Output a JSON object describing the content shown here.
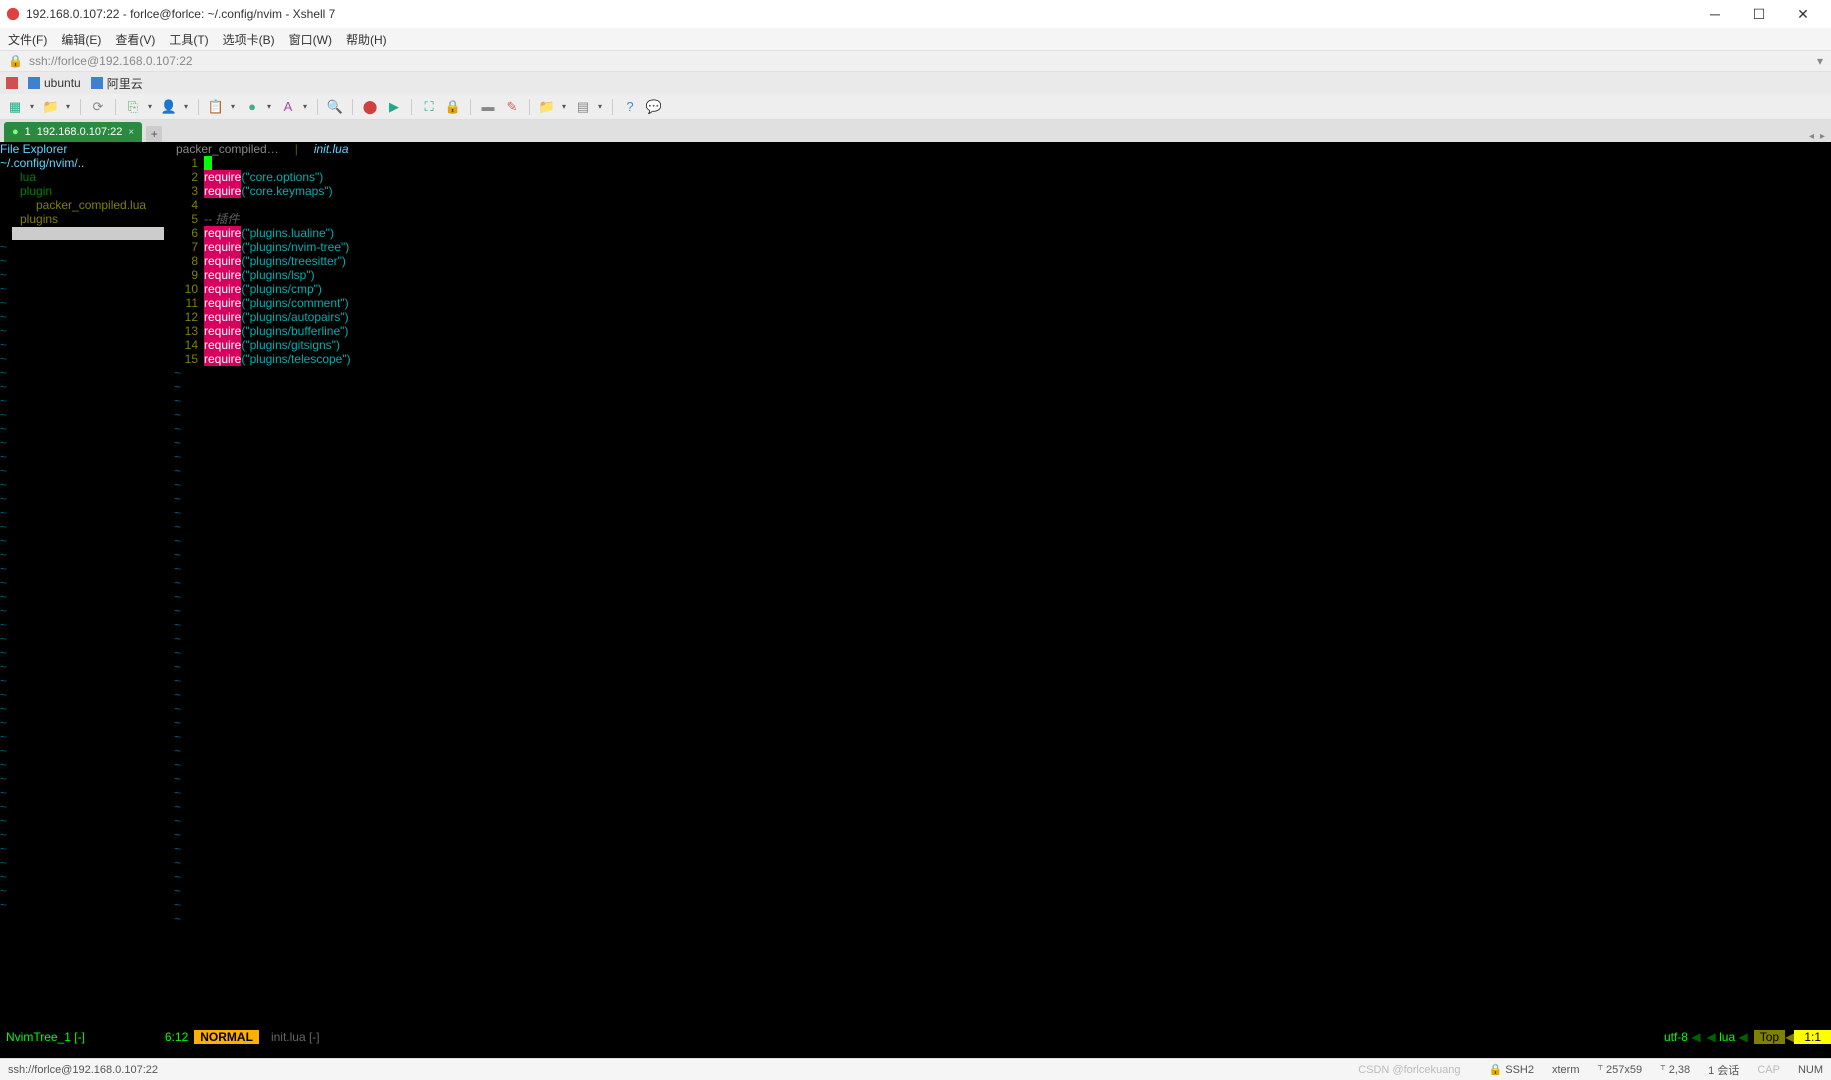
{
  "window": {
    "title": "192.168.0.107:22 - forlce@forlce: ~/.config/nvim - Xshell 7"
  },
  "menubar": {
    "items": [
      "文件(F)",
      "编辑(E)",
      "查看(V)",
      "工具(T)",
      "选项卡(B)",
      "窗口(W)",
      "帮助(H)"
    ]
  },
  "addressbar": {
    "url": "ssh://forlce@192.168.0.107:22"
  },
  "sessions": {
    "items": [
      "ubuntu",
      "阿里云"
    ]
  },
  "tab": {
    "index": "1",
    "label": "192.168.0.107:22"
  },
  "nvimtree": {
    "header": "File Explorer",
    "path": "~/.config/nvim/..",
    "items": [
      {
        "name": "lua",
        "type": "dir"
      },
      {
        "name": "plugin",
        "type": "dir"
      },
      {
        "name": "packer_compiled.lua",
        "type": "file"
      },
      {
        "name": "plugins",
        "type": "dir2"
      }
    ]
  },
  "buffers": {
    "inactive": "packer_compiled…",
    "sep": "|",
    "active": "init.lua"
  },
  "code": {
    "comment": "-- 插件",
    "lines": [
      {
        "n": 1,
        "type": "cursor"
      },
      {
        "n": 2,
        "type": "req",
        "arg": "\"core.options\""
      },
      {
        "n": 3,
        "type": "req",
        "arg": "\"core.keymaps\""
      },
      {
        "n": 4,
        "type": "blank"
      },
      {
        "n": 5,
        "type": "comment"
      },
      {
        "n": 6,
        "type": "req",
        "arg": "\"plugins.lualine\""
      },
      {
        "n": 7,
        "type": "req",
        "arg": "\"plugins/nvim-tree\""
      },
      {
        "n": 8,
        "type": "req",
        "arg": "\"plugins/treesitter\""
      },
      {
        "n": 9,
        "type": "req",
        "arg": "\"plugins/lsp\""
      },
      {
        "n": 10,
        "type": "req",
        "arg": "\"plugins/cmp\""
      },
      {
        "n": 11,
        "type": "req",
        "arg": "\"plugins/comment\""
      },
      {
        "n": 12,
        "type": "req",
        "arg": "\"plugins/autopairs\""
      },
      {
        "n": 13,
        "type": "req",
        "arg": "\"plugins/bufferline\""
      },
      {
        "n": 14,
        "type": "req",
        "arg": "\"plugins/gitsigns\""
      },
      {
        "n": 15,
        "type": "req",
        "arg": "\"plugins/telescope\""
      }
    ],
    "keyword": "require"
  },
  "statusline": {
    "left": "NvimTree_1 [-]",
    "pos": "6:12",
    "mode": "NORMAL",
    "branch": "",
    "fname": "init.lua [-]",
    "enc": "utf-8",
    "ft": "lua",
    "top": "Top",
    "loc": "1:1"
  },
  "bottombar": {
    "addr": "ssh://forlce@192.168.0.107:22",
    "watermark": "CSDN @forlcekuang",
    "proto": "SSH2",
    "term": "xterm",
    "size": "257x59",
    "cursor": "2,38",
    "sess": "1 会话",
    "cap": "CAP",
    "num": "NUM"
  }
}
